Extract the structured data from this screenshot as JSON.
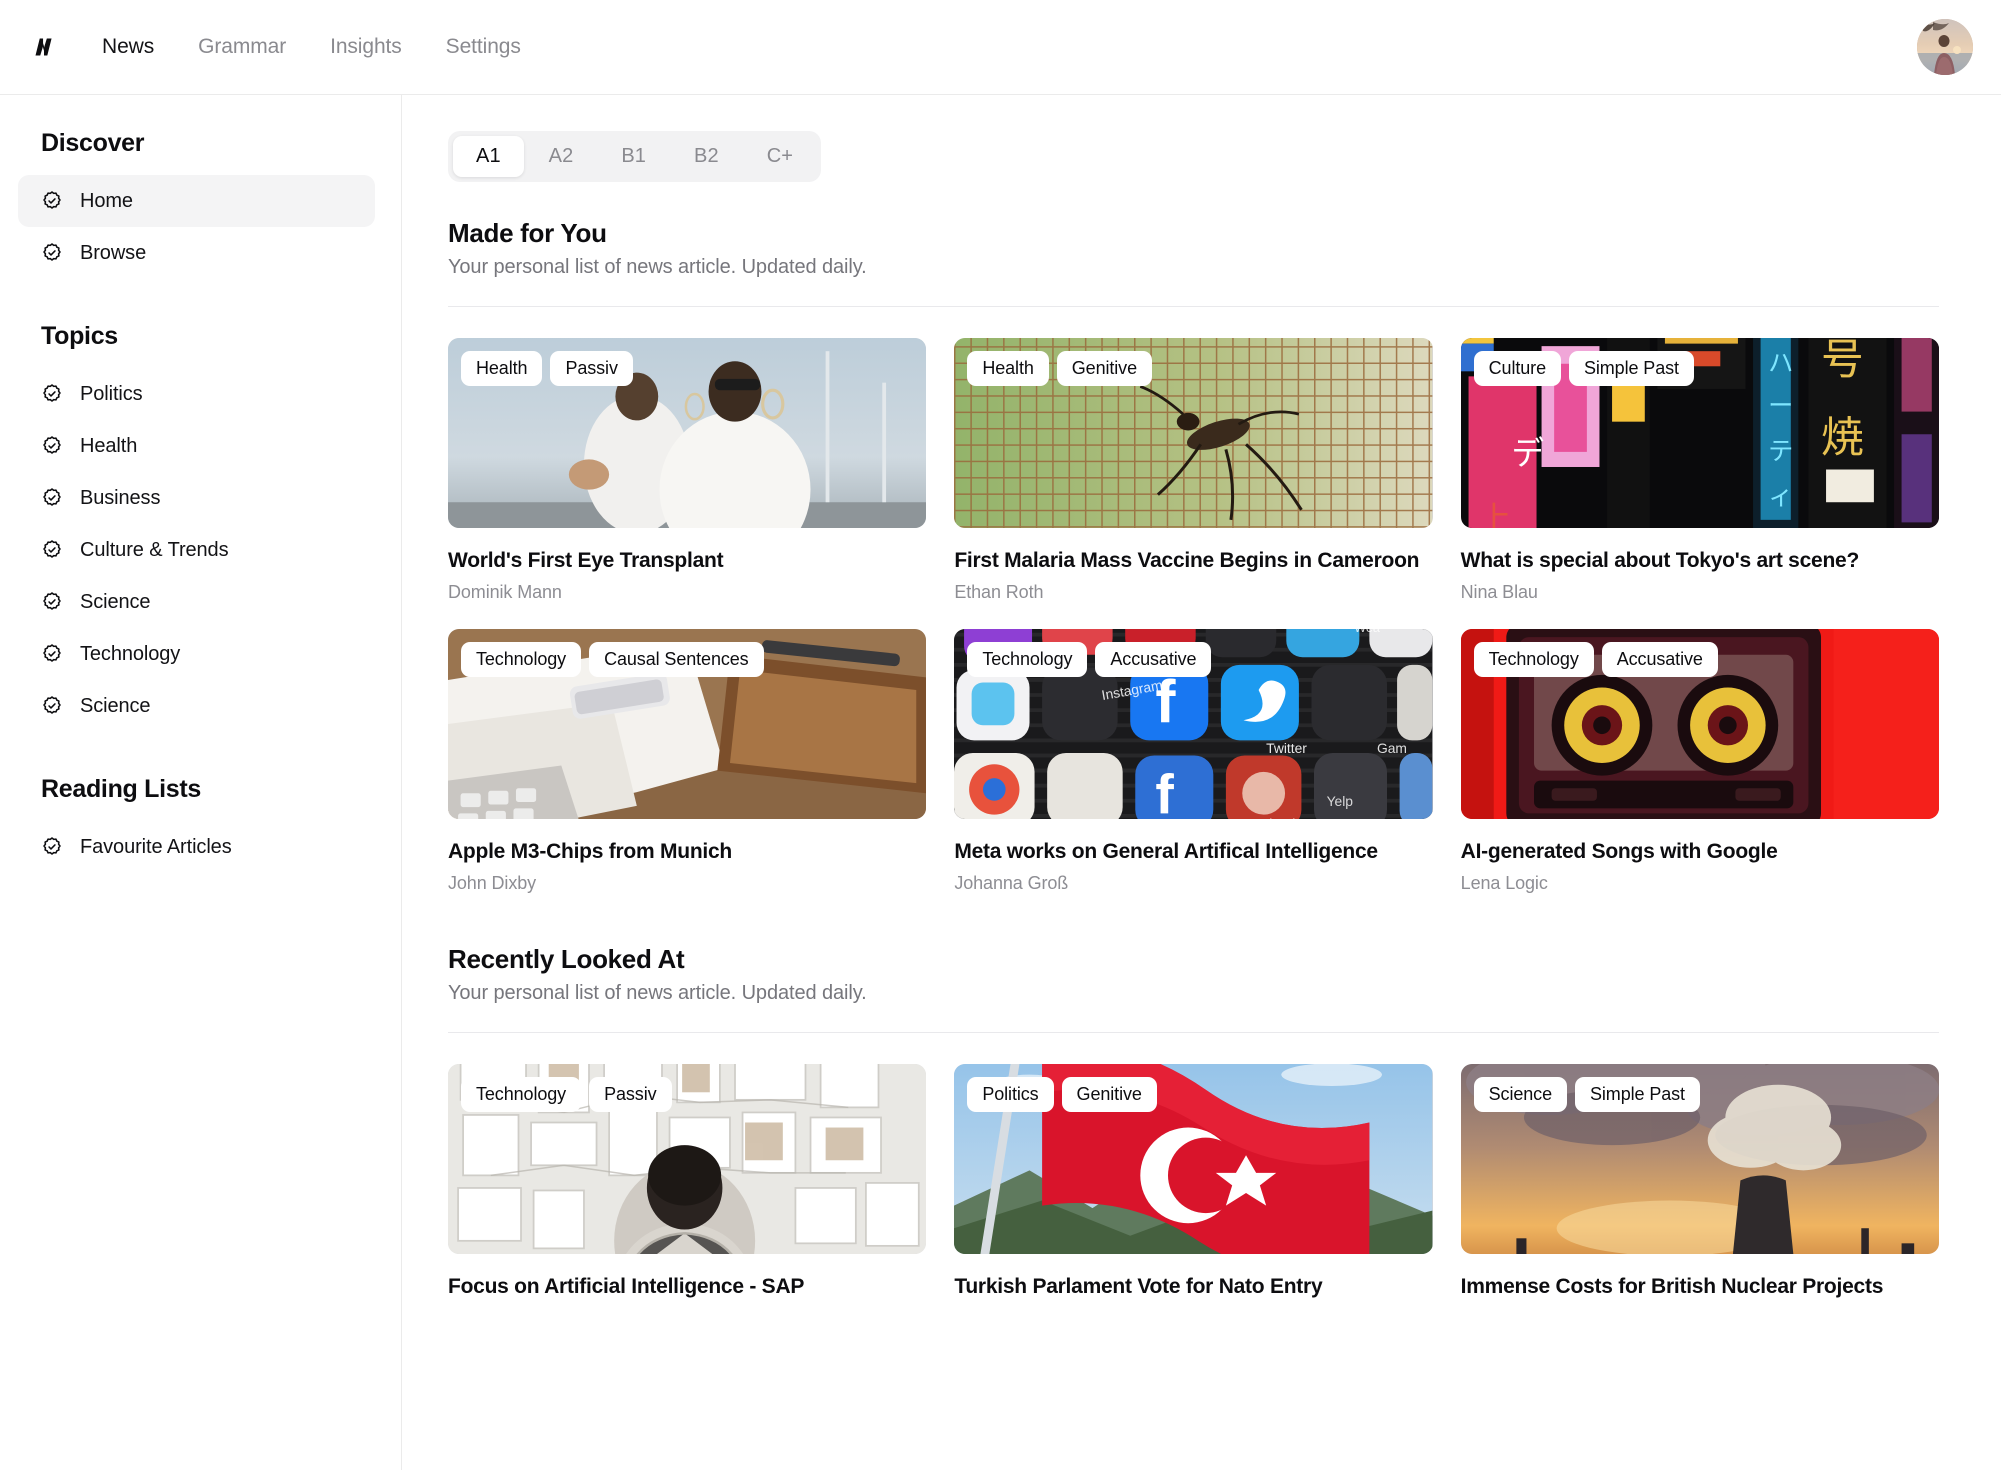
{
  "topnav": {
    "logo_icon": "logo-n-icon",
    "items": [
      {
        "label": "News",
        "active": true
      },
      {
        "label": "Grammar",
        "active": false
      },
      {
        "label": "Insights",
        "active": false
      },
      {
        "label": "Settings",
        "active": false
      }
    ],
    "avatar_alt": "user-avatar"
  },
  "sidebar": {
    "discover_heading": "Discover",
    "discover_items": [
      {
        "label": "Home",
        "icon": "badge-check-icon",
        "active": true
      },
      {
        "label": "Browse",
        "icon": "badge-check-icon",
        "active": false
      }
    ],
    "topics_heading": "Topics",
    "topics_items": [
      {
        "label": "Politics",
        "icon": "badge-check-icon"
      },
      {
        "label": "Health",
        "icon": "badge-check-icon"
      },
      {
        "label": "Business",
        "icon": "badge-check-icon"
      },
      {
        "label": "Culture & Trends",
        "icon": "badge-check-icon"
      },
      {
        "label": "Science",
        "icon": "badge-check-icon"
      },
      {
        "label": "Technology",
        "icon": "badge-check-icon"
      },
      {
        "label": "Science",
        "icon": "badge-check-icon"
      }
    ],
    "lists_heading": "Reading Lists",
    "lists_items": [
      {
        "label": "Favourite Articles",
        "icon": "badge-check-icon"
      }
    ]
  },
  "levels": {
    "options": [
      {
        "label": "A1",
        "active": true
      },
      {
        "label": "A2",
        "active": false
      },
      {
        "label": "B1",
        "active": false
      },
      {
        "label": "B2",
        "active": false
      },
      {
        "label": "C+",
        "active": false
      }
    ]
  },
  "sections": [
    {
      "title": "Made for You",
      "subtitle": "Your personal list of news article. Updated daily.",
      "cards": [
        {
          "tags": [
            "Health",
            "Passiv"
          ],
          "title": "World's First Eye Transplant",
          "author": "Dominik Mann",
          "image": "two-people-in-white-on-a-boat-deck"
        },
        {
          "tags": [
            "Health",
            "Genitive"
          ],
          "title": "First Malaria Mass Vaccine Begins in Cameroon",
          "author": "Ethan Roth",
          "image": "mosquito-on-green-window-mesh"
        },
        {
          "tags": [
            "Culture",
            "Simple Past"
          ],
          "title": "What is special about Tokyo's art scene?",
          "author": "Nina Blau",
          "image": "tokyo-neon-signs-at-night"
        },
        {
          "tags": [
            "Technology",
            "Causal Sentences"
          ],
          "title": "Apple M3-Chips from Munich",
          "author": "John Dixby",
          "image": "laptop-phone-and-notebook-on-desk"
        },
        {
          "tags": [
            "Technology",
            "Accusative"
          ],
          "title": "Meta works on General Artifical Intelligence",
          "author": "Johanna Groß",
          "image": "social-media-app-icons-on-phone-screen"
        },
        {
          "tags": [
            "Technology",
            "Accusative"
          ],
          "title": "AI-generated Songs with Google",
          "author": "Lena Logic",
          "image": "cassette-tape-on-red-background"
        }
      ]
    },
    {
      "title": "Recently Looked At",
      "subtitle": "Your personal list of news article. Updated daily.",
      "cards": [
        {
          "tags": [
            "Technology",
            "Passiv"
          ],
          "title": "Focus on Artificial Intelligence - SAP",
          "author": "",
          "image": "person-looking-at-wall-of-papers"
        },
        {
          "tags": [
            "Politics",
            "Genitive"
          ],
          "title": "Turkish Parlament Vote for Nato Entry",
          "author": "",
          "image": "turkish-flag-waving-over-mountains"
        },
        {
          "tags": [
            "Science",
            "Simple Past"
          ],
          "title": "Immense Costs for British Nuclear Projects",
          "author": "",
          "image": "nuclear-cooling-tower-at-sunset"
        }
      ]
    }
  ],
  "colors": {
    "text_primary": "#0d0d10",
    "text_muted": "#8a8a8f",
    "active_pill_bg": "#f4f4f5",
    "segment_bg": "#f2f2f3",
    "border": "#ebebeb"
  }
}
